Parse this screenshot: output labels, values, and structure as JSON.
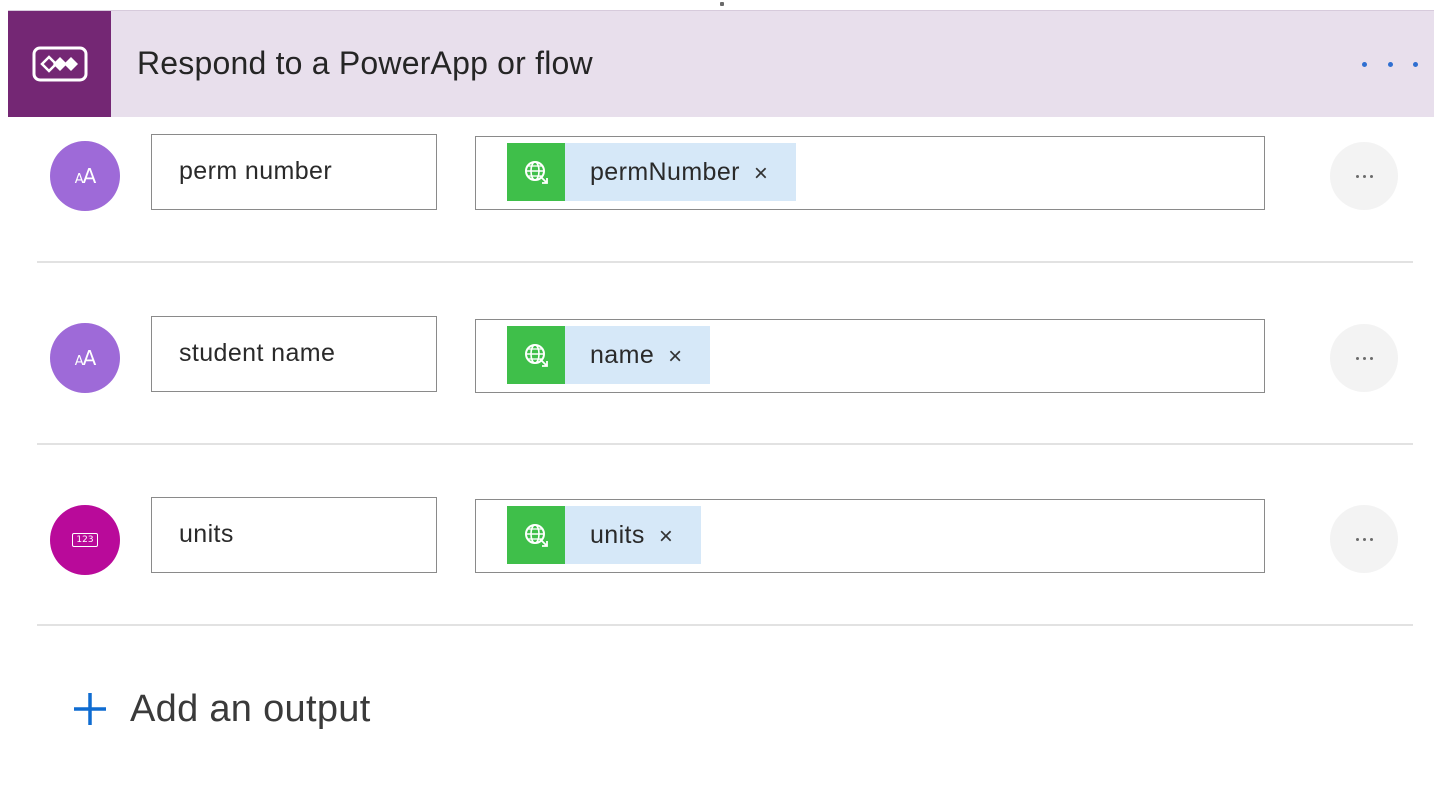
{
  "header": {
    "title": "Respond to a PowerApp or flow",
    "icon": "powerapps-icon",
    "more_icon": "more-options-icon",
    "accent": "#742774",
    "background": "#e8dfec"
  },
  "outputs": [
    {
      "type_icon": "text-type-icon",
      "type_glyph": "AA",
      "key": "perm number",
      "token": "permNumber",
      "token_icon": "globe-icon",
      "remove": "×"
    },
    {
      "type_icon": "text-type-icon",
      "type_glyph": "AA",
      "key": "student name",
      "token": "name",
      "token_icon": "globe-icon",
      "remove": "×"
    },
    {
      "type_icon": "number-type-icon",
      "type_glyph": "123",
      "key": "units",
      "token": "units",
      "token_icon": "globe-icon",
      "remove": "×"
    }
  ],
  "add_output": {
    "label": "Add an output",
    "icon": "plus-icon",
    "color": "#0f6cd1"
  },
  "colors": {
    "text_avatar": "#9e6ad8",
    "number_avatar": "#b90a9a",
    "token_bg": "#d6e8f8",
    "token_icon_bg": "#3fbf4a"
  }
}
